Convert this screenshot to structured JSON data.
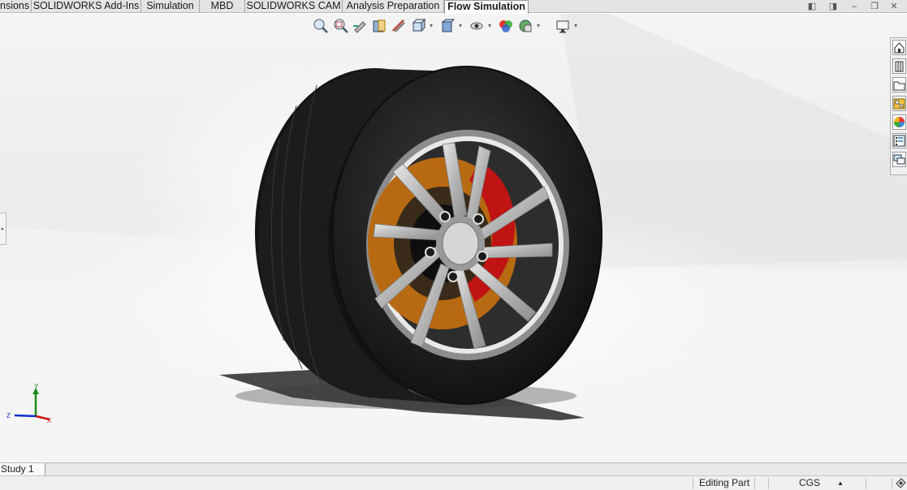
{
  "tabs": [
    {
      "label": "nsions",
      "active": false
    },
    {
      "label": "SOLIDWORKS Add-Ins",
      "active": false
    },
    {
      "label": "Simulation",
      "active": false
    },
    {
      "label": "MBD",
      "active": false
    },
    {
      "label": "SOLIDWORKS CAM",
      "active": false
    },
    {
      "label": "Analysis Preparation",
      "active": false
    },
    {
      "label": "Flow Simulation",
      "active": true
    }
  ],
  "triad": {
    "x": "X",
    "y": "Y",
    "z": "Z"
  },
  "study_tab": "Study 1",
  "status": {
    "mode": "Editing Part",
    "units": "CGS",
    "units_caret": "▲"
  },
  "colors": {
    "tire": "#1b1b1b",
    "rim": "#c9c9c9",
    "caliper": "#c01414",
    "disc": "#b86a12"
  }
}
